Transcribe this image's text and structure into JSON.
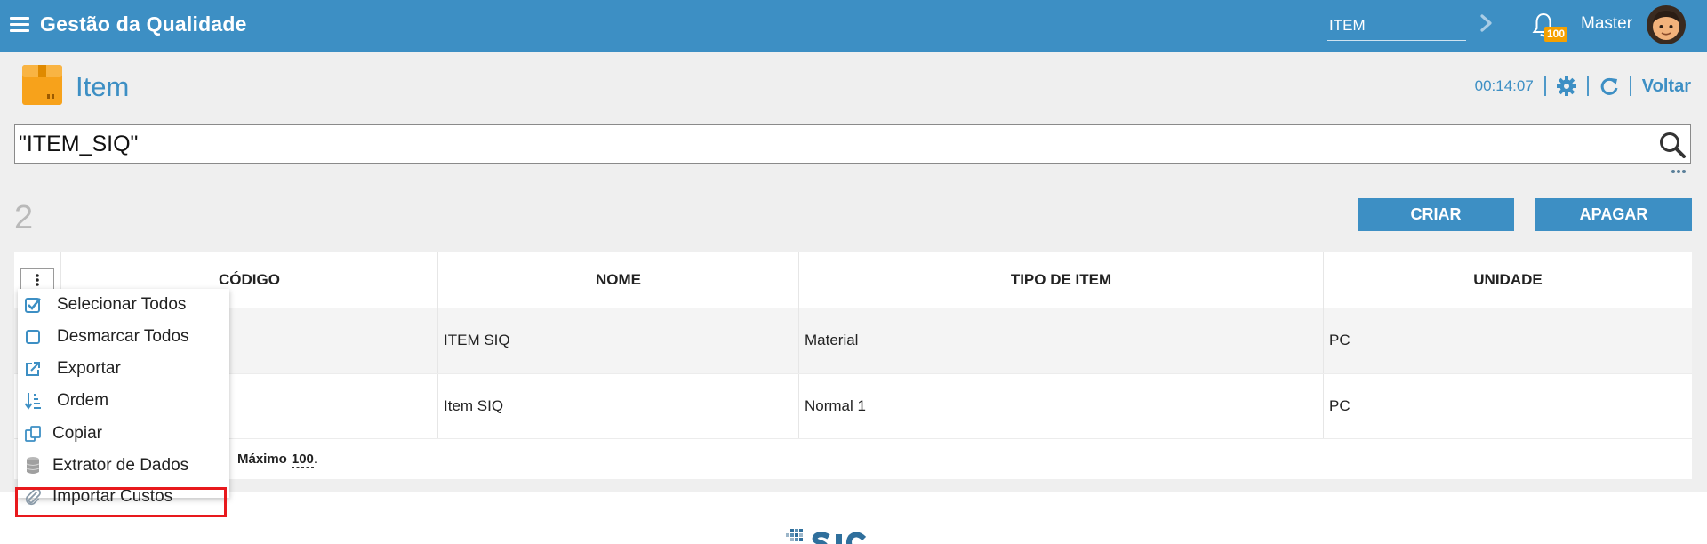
{
  "app": {
    "title": "Gestão da Qualidade",
    "module_search_value": "ITEM",
    "notification_count": "100",
    "user_name": "Master"
  },
  "page": {
    "title": "Item",
    "timer": "00:14:07",
    "back_label": "Voltar",
    "search_value": "\"ITEM_SIQ\"",
    "record_count": "2"
  },
  "buttons": {
    "create": "CRIAR",
    "delete": "APAGAR"
  },
  "table": {
    "columns": [
      "CÓDIGO",
      "NOME",
      "TIPO DE ITEM",
      "UNIDADE"
    ],
    "rows": [
      {
        "nome": "ITEM SIQ",
        "tipo": "Material",
        "unidade": "PC"
      },
      {
        "nome": "Item SIQ",
        "tipo": "Normal 1",
        "unidade": "PC"
      }
    ],
    "footer_label": "Máximo",
    "footer_max": "100"
  },
  "menu": {
    "items": [
      {
        "label": "Selecionar Todos",
        "icon": "check-square-icon"
      },
      {
        "label": "Desmarcar Todos",
        "icon": "square-icon"
      },
      {
        "label": "Exportar",
        "icon": "export-icon"
      },
      {
        "label": "Ordem",
        "icon": "sort-icon"
      },
      {
        "label": "Copiar",
        "icon": "copy-icon"
      },
      {
        "label": "Extrator de Dados",
        "icon": "database-icon"
      },
      {
        "label": "Importar Custos",
        "icon": "paperclip-icon"
      }
    ]
  },
  "colors": {
    "brand_blue": "#3d8fc4",
    "accent_orange": "#f5a000",
    "highlight_red": "#e8191d"
  }
}
